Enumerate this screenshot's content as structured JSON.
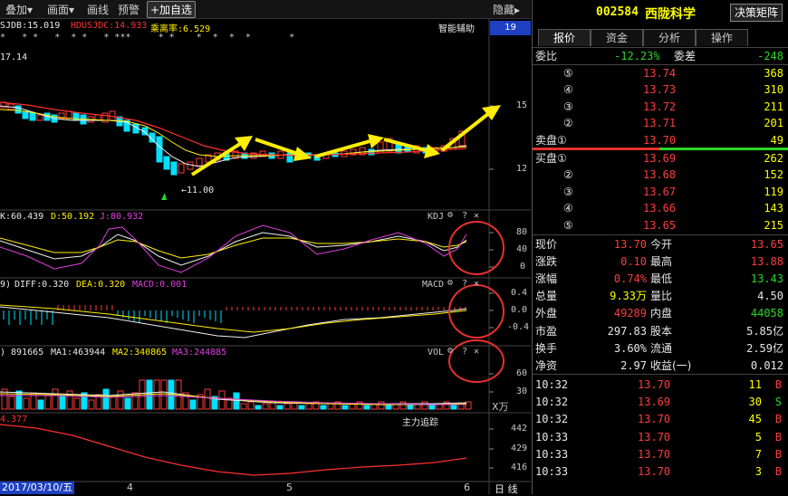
{
  "toolbar": {
    "overlay": "叠加▾",
    "draw": "画面▾",
    "line": "画线",
    "alert": "预警",
    "add_watch": "+加自选",
    "hide": "隐藏▸"
  },
  "main_chart": {
    "h_sjdb": "SJDB:15.019",
    "h_hdusjdc": "HDUSJDC:14.933",
    "h_bias": "乘离率:6.529",
    "aux_label": "智能辅助",
    "stars": "*   * *   *  * *   * ***     * *    *  *  *  *       *",
    "price_max": "17.14",
    "price_min": "←11.00",
    "period_box": "19",
    "yticks": [
      "15",
      "12"
    ]
  },
  "kdj": {
    "k": "K:60.439",
    "d": "D:50.192",
    "j": "J:80.932",
    "label": "KDJ",
    "yticks": [
      "80",
      "40",
      "0"
    ]
  },
  "macd": {
    "params": "9)",
    "diff": "DIFF:0.320",
    "dea": "DEA:0.320",
    "macd": "MACD:0.001",
    "label": "MACD",
    "yticks": [
      "0.4",
      "0.0",
      "-0.4"
    ]
  },
  "vol": {
    "vol": ") 891665",
    "ma1": "MA1:463944",
    "ma2": "MA2:340865",
    "ma3": "MA3:244885",
    "label": "VOL",
    "yticks": [
      "60",
      "30",
      "X万"
    ]
  },
  "tracker": {
    "value": "4.377",
    "label": "主力追踪",
    "yticks": [
      "442",
      "429",
      "416"
    ]
  },
  "xaxis": {
    "date": "2017/03/10/五",
    "m4": "4",
    "m5": "5",
    "m6": "6",
    "period": "日 线"
  },
  "controls": {
    "gear": "⚙",
    "help": "?",
    "close": "✕"
  },
  "panel": {
    "code": "002584",
    "name": "西陇科学",
    "matrix_btn": "决策矩阵",
    "tabs": [
      "报价",
      "资金",
      "分析",
      "操作"
    ],
    "weibi_label": "委比",
    "weibi_value": "-12.23%",
    "weicha_label": "委差",
    "weicha_value": "-248",
    "asks": [
      {
        "level": "⑤",
        "price": "13.74",
        "vol": "368"
      },
      {
        "level": "④",
        "price": "13.73",
        "vol": "310"
      },
      {
        "level": "③",
        "price": "13.72",
        "vol": "211"
      },
      {
        "level": "②",
        "price": "13.71",
        "vol": "201"
      },
      {
        "level": "卖盘①",
        "price": "13.70",
        "vol": "49"
      }
    ],
    "bids": [
      {
        "level": "买盘①",
        "price": "13.69",
        "vol": "262"
      },
      {
        "level": "②",
        "price": "13.68",
        "vol": "152"
      },
      {
        "level": "③",
        "price": "13.67",
        "vol": "119"
      },
      {
        "level": "④",
        "price": "13.66",
        "vol": "143"
      },
      {
        "level": "⑤",
        "price": "13.65",
        "vol": "215"
      }
    ],
    "quote": [
      {
        "l1": "现价",
        "v1": "13.70",
        "l2": "今开",
        "v2": "13.65"
      },
      {
        "l1": "涨跌",
        "v1": "0.10",
        "l2": "最高",
        "v2": "13.88"
      },
      {
        "l1": "涨幅",
        "v1": "0.74%",
        "l2": "最低",
        "v2": "13.43"
      },
      {
        "l1": "总量",
        "v1": "9.33万",
        "l2": "量比",
        "v2": "4.50"
      },
      {
        "l1": "外盘",
        "v1": "49289",
        "l2": "内盘",
        "v2": "44058"
      },
      {
        "l1": "市盈",
        "v1": "297.83",
        "l2": "股本",
        "v2": "5.85亿"
      },
      {
        "l1": "换手",
        "v1": "3.60%",
        "l2": "流通",
        "v2": "2.59亿"
      },
      {
        "l1": "净资",
        "v1": "2.97",
        "l2": "收益(一)",
        "v2": "0.012"
      }
    ],
    "trades": [
      {
        "time": "10:32",
        "price": "13.70",
        "vol": "11",
        "side": "B"
      },
      {
        "time": "10:32",
        "price": "13.69",
        "vol": "30",
        "side": "S"
      },
      {
        "time": "10:32",
        "price": "13.70",
        "vol": "45",
        "side": "B"
      },
      {
        "time": "10:33",
        "price": "13.70",
        "vol": "5",
        "side": "B"
      },
      {
        "time": "10:33",
        "price": "13.70",
        "vol": "7",
        "side": "B"
      },
      {
        "time": "10:33",
        "price": "13.70",
        "vol": "3",
        "side": "B"
      }
    ]
  },
  "colors": {
    "up": "#ff3c3c",
    "down": "#00e0ff",
    "flat_green": "#29d629",
    "arrow": "#ffee00",
    "circle": "#e83030"
  }
}
